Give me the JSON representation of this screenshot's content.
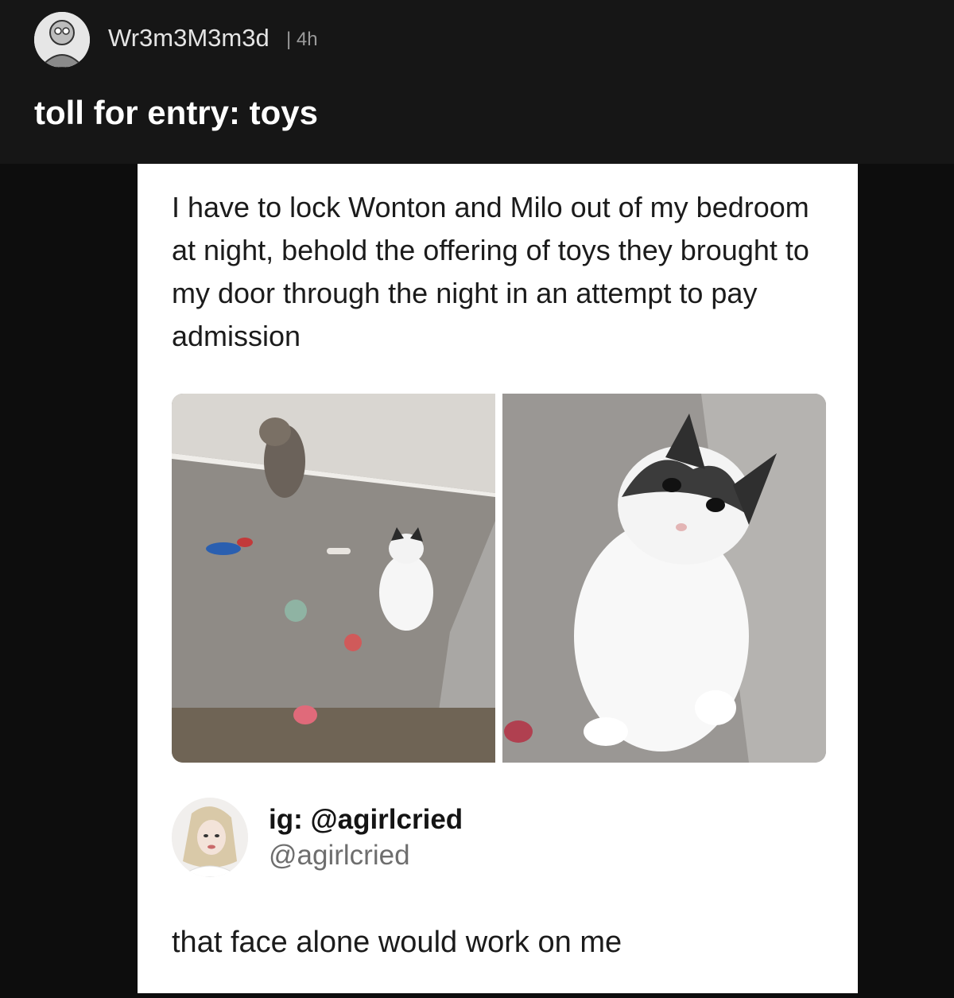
{
  "post": {
    "username": "Wr3m3M3m3d",
    "age": "| 4h",
    "title": "toll for entry: toys"
  },
  "tweet": {
    "text": "I have to lock Wonton and Milo out of my bedroom at night, behold the offering of toys they brought to my door through the night in an attempt to pay admission",
    "author_name": "ig: @agirlcried",
    "author_handle": "@agirlcried",
    "reply": "that face alone would work on me"
  }
}
